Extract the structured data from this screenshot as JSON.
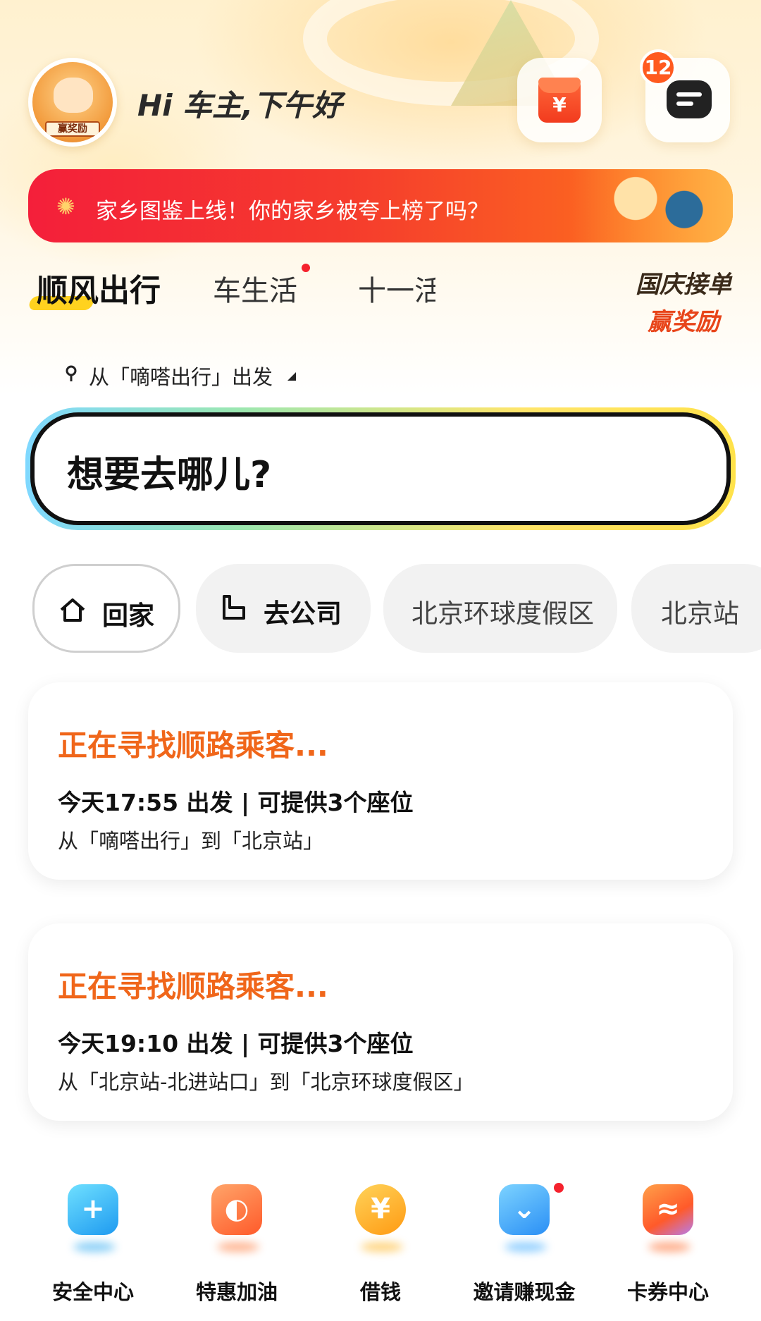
{
  "header": {
    "avatar_badge": "赢奖励",
    "greeting": "Hi 车主,下午好",
    "redpacket_glyph": "¥",
    "message_count": "12"
  },
  "banner": {
    "text": "家乡图鉴上线！你的家乡被夸上榜了吗？",
    "icon": "firework-icon"
  },
  "tabs": {
    "items": [
      {
        "label": "顺风出行",
        "active": true
      },
      {
        "label": "车生活",
        "has_dot": true
      },
      {
        "label": "十一活"
      }
    ],
    "promo_line1": "国庆接单",
    "promo_line2": "赢奖励"
  },
  "origin": {
    "text": "从「嘀嗒出行」出发"
  },
  "search": {
    "placeholder": "想要去哪儿?"
  },
  "quick_destinations": [
    {
      "label": "回家",
      "icon": "house-icon"
    },
    {
      "label": "去公司",
      "icon": "building-icon"
    },
    {
      "label": "北京环球度假区"
    },
    {
      "label": "北京站"
    }
  ],
  "trips": [
    {
      "status": "正在寻找顺路乘客...",
      "time": "今天17:55 出发 | 可提供3个座位",
      "route": "从「嘀嗒出行」到「北京站」"
    },
    {
      "status": "正在寻找顺路乘客...",
      "time": "今天19:10 出发 | 可提供3个座位",
      "route": "从「北京站-北进站口」到「北京环球度假区」"
    }
  ],
  "services": [
    {
      "label": "安全中心",
      "icon": "shield-icon",
      "glyph": "+",
      "color": "#2aa8f0"
    },
    {
      "label": "特惠加油",
      "icon": "fuel-drop-icon",
      "glyph": "◐",
      "color": "#ff7a3a"
    },
    {
      "label": "借钱",
      "icon": "yuan-coin-icon",
      "glyph": "¥",
      "color": "#ffb21a"
    },
    {
      "label": "邀请赚现金",
      "icon": "envelope-icon",
      "glyph": "⌄",
      "color": "#3aa9ff",
      "has_dot": true
    },
    {
      "label": "卡券中心",
      "icon": "ticket-icon",
      "glyph": "≈",
      "color": "#ff6a2a"
    }
  ]
}
